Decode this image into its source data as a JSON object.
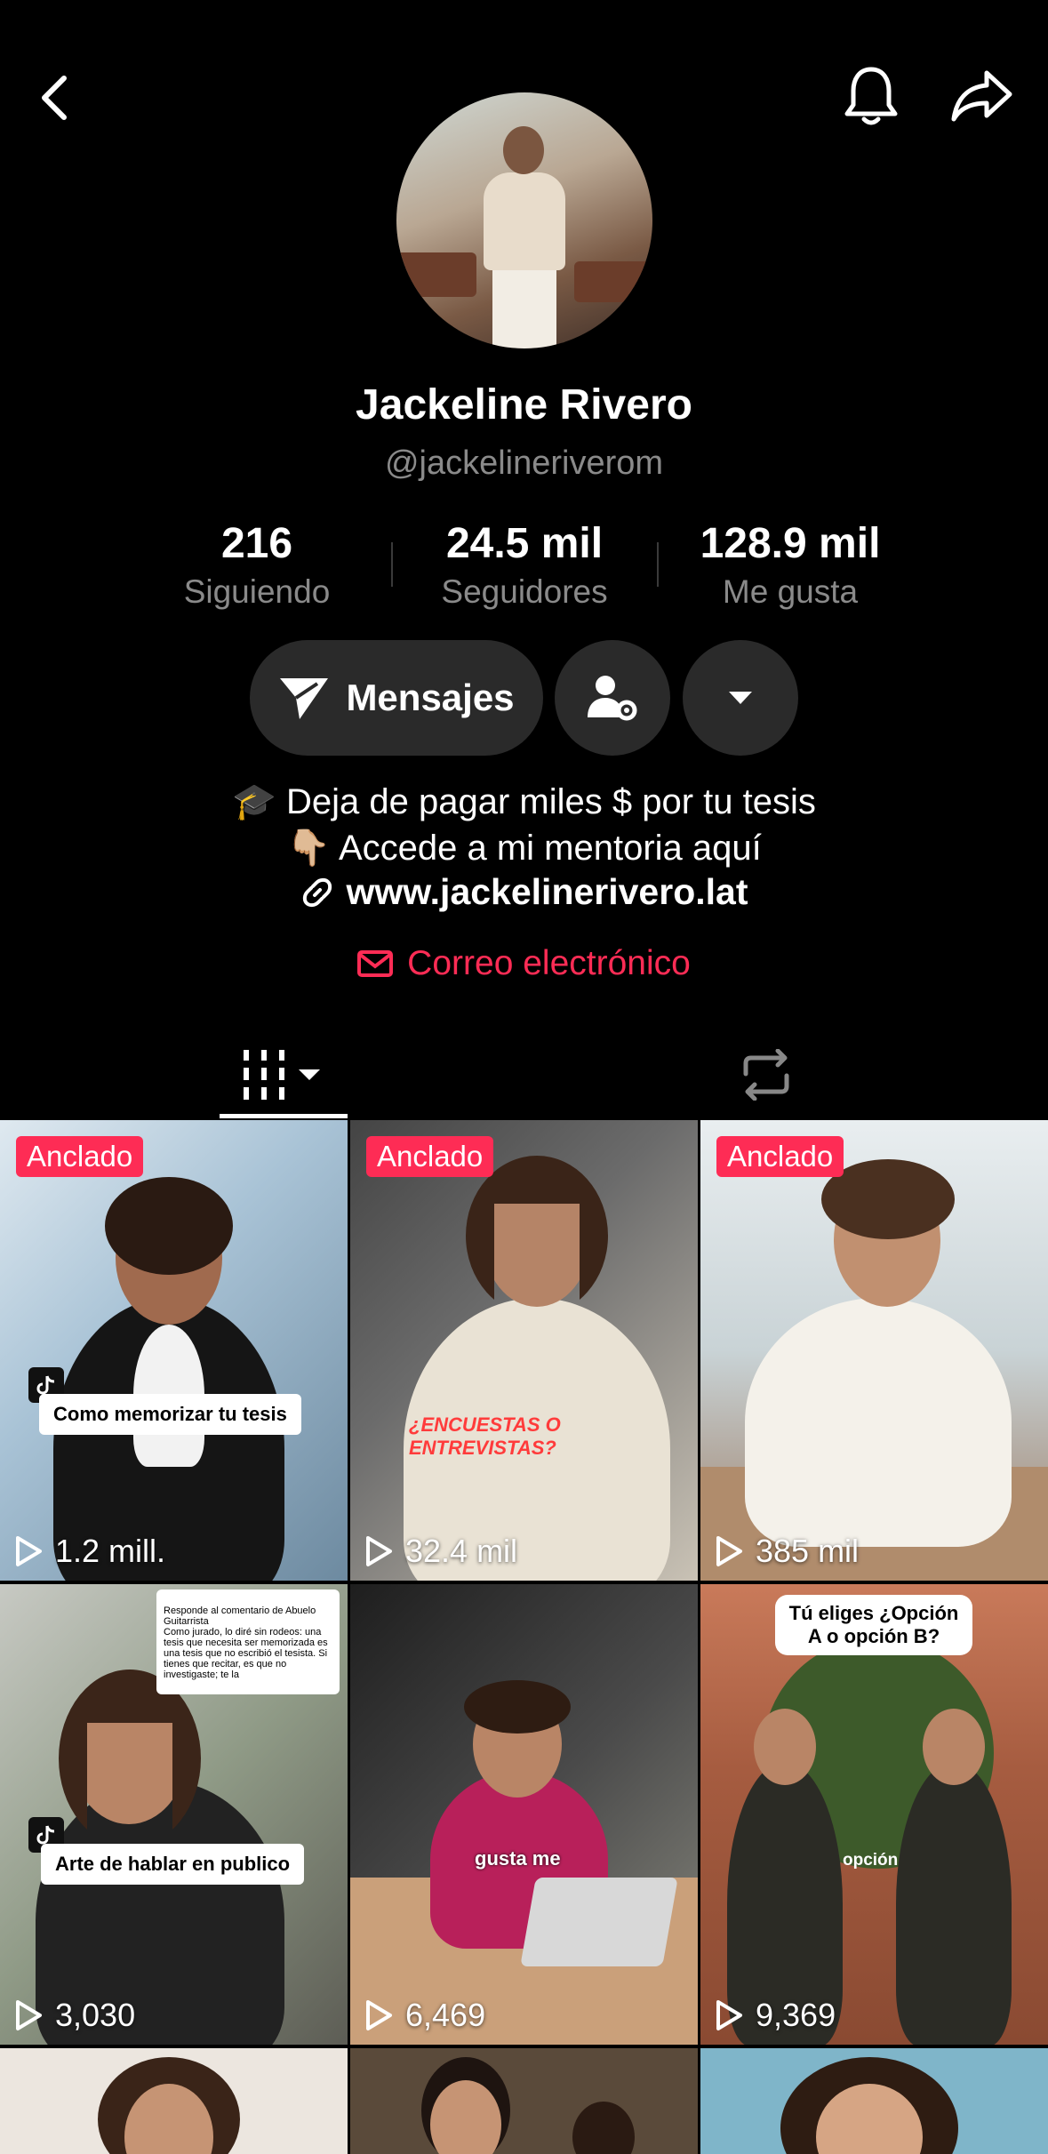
{
  "profile": {
    "name": "Jackeline Rivero",
    "handle": "@jackelineriverom"
  },
  "stats": [
    {
      "value": "216",
      "label": "Siguiendo"
    },
    {
      "value": "24.5 mil",
      "label": "Seguidores"
    },
    {
      "value": "128.9 mil",
      "label": "Me gusta"
    }
  ],
  "actions": {
    "message_label": "Mensajes"
  },
  "bio": {
    "line1": "🎓 Deja de pagar miles $ por tu tesis",
    "line2": "👇🏼 Accede a mi mentoria aquí",
    "link": "www.jackelinerivero.lat",
    "email_label": "Correo electrónico"
  },
  "colors": {
    "accent": "#fe2c55",
    "background": "#000000",
    "button_bg": "#2a2a2a"
  },
  "icons": [
    "back-icon",
    "bell-icon",
    "share-icon",
    "send-icon",
    "user-settings-icon",
    "chevron-down-icon",
    "link-icon",
    "mail-icon",
    "videos-grid-icon",
    "repost-icon",
    "play-icon"
  ],
  "videos": [
    {
      "pinned_label": "Anclado",
      "views": "1.2 mill.",
      "caption": "Como memorizar tu tesis"
    },
    {
      "pinned_label": "Anclado",
      "views": "32.4 mil",
      "caption": "¿ENCUESTAS O ENTREVISTAS?"
    },
    {
      "pinned_label": "Anclado",
      "views": "385 mil"
    },
    {
      "views": "3,030",
      "caption": "Arte de hablar en publico",
      "comment": "Responde al comentario de Abuelo Guitarrista\nComo jurado, lo diré sin rodeos: una tesis que necesita ser memorizada es una tesis que no escribió el tesista. Si tienes que recitar, es que no investigaste; te la"
    },
    {
      "views": "6,469",
      "caption": "gusta me"
    },
    {
      "views": "9,369",
      "caption": "Tú eliges ¿Opción A o opción B?",
      "subcaption": "opción"
    }
  ]
}
